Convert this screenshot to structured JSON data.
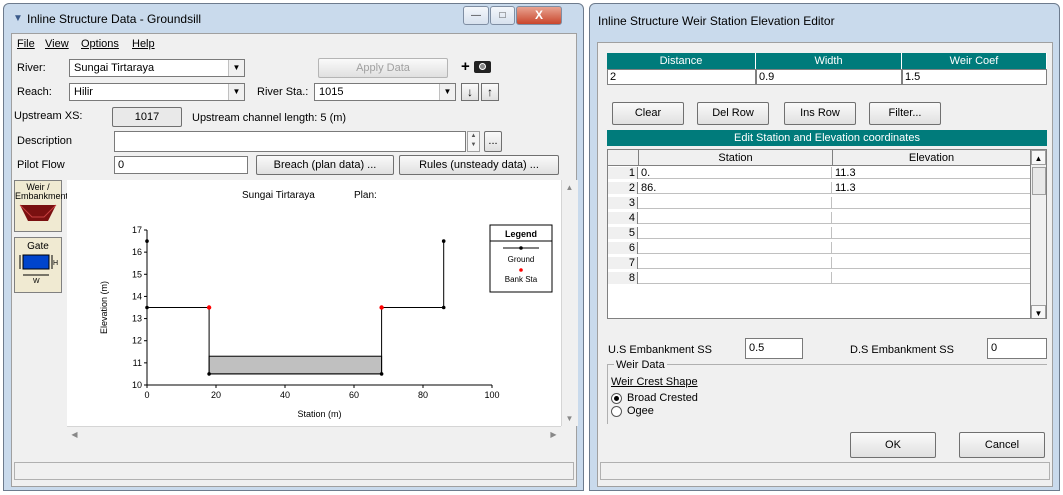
{
  "left_window": {
    "title": "Inline Structure Data - Groundsill",
    "menu": [
      "File",
      "View",
      "Options",
      "Help"
    ],
    "river_label": "River:",
    "river_value": "Sungai Tirtaraya",
    "apply_label": "Apply Data",
    "reach_label": "Reach:",
    "reach_value": "Hilir",
    "river_sta_label": "River Sta.:",
    "river_sta_value": "1015",
    "upstream_xs_label": "Upstream XS:",
    "upstream_xs_value": "1017",
    "upstream_length": "Upstream channel length: 5 (m)",
    "description_label": "Description",
    "description_value": "",
    "ellipsis_label": "...",
    "pilot_flow_label": "Pilot Flow",
    "pilot_flow_value": "0",
    "breach_label": "Breach (plan data) ...",
    "rules_label": "Rules (unsteady data) ...",
    "weir_tool_label": "Weir / Embankment",
    "gate_tool_label": "Gate",
    "gate_h": "H",
    "gate_w": "W",
    "plot": {
      "title": "Sungai Tirtaraya",
      "plan_label": "Plan:",
      "legend_title": "Legend",
      "legend_ground": "Ground",
      "legend_bank": "Bank Sta",
      "colors": {
        "ground": "#000000",
        "bank": "#ff0000",
        "fill": "#c0c0c0"
      }
    }
  },
  "chart_data": {
    "type": "line",
    "xlabel": "Station (m)",
    "ylabel": "Elevation (m)",
    "xlim": [
      0,
      100
    ],
    "ylim": [
      10,
      17
    ],
    "x_ticks": [
      0,
      20,
      40,
      60,
      80,
      100
    ],
    "y_ticks": [
      10,
      11,
      12,
      13,
      14,
      15,
      16,
      17
    ],
    "series": [
      {
        "name": "Ground",
        "points": [
          [
            0,
            16.5
          ],
          [
            0,
            13.5
          ],
          [
            18,
            13.5
          ],
          [
            18,
            10.5
          ],
          [
            68,
            10.5
          ],
          [
            68,
            13.5
          ],
          [
            86,
            13.5
          ],
          [
            86,
            16.5
          ]
        ]
      },
      {
        "name": "Bank Sta",
        "points": [
          [
            18,
            13.5
          ],
          [
            68,
            13.5
          ]
        ]
      }
    ],
    "weir": {
      "x_start": 18,
      "x_end": 68,
      "bottom": 10.5,
      "top": 11.3
    }
  },
  "right_window": {
    "title": "Inline Structure Weir Station Elevation Editor",
    "headers": [
      "Distance",
      "Width",
      "Weir Coef"
    ],
    "values": [
      "2",
      "0.9",
      "1.5"
    ],
    "buttons": [
      "Clear",
      "Del Row",
      "Ins Row",
      "Filter..."
    ],
    "table_title": "Edit Station and Elevation coordinates",
    "col_station": "Station",
    "col_elevation": "Elevation",
    "rows": [
      {
        "n": "1",
        "station": "0.",
        "elevation": "11.3"
      },
      {
        "n": "2",
        "station": "86.",
        "elevation": "11.3"
      },
      {
        "n": "3",
        "station": "",
        "elevation": ""
      },
      {
        "n": "4",
        "station": "",
        "elevation": ""
      },
      {
        "n": "5",
        "station": "",
        "elevation": ""
      },
      {
        "n": "6",
        "station": "",
        "elevation": ""
      },
      {
        "n": "7",
        "station": "",
        "elevation": ""
      },
      {
        "n": "8",
        "station": "",
        "elevation": ""
      }
    ],
    "us_ss_label": "U.S Embankment SS",
    "us_ss_value": "0.5",
    "ds_ss_label": "D.S Embankment SS",
    "ds_ss_value": "0",
    "weir_data_label": "Weir Data",
    "crest_shape_label": "Weir Crest Shape",
    "broad_crested": "Broad Crested",
    "ogee": "Ogee",
    "ok_label": "OK",
    "cancel_label": "Cancel"
  }
}
